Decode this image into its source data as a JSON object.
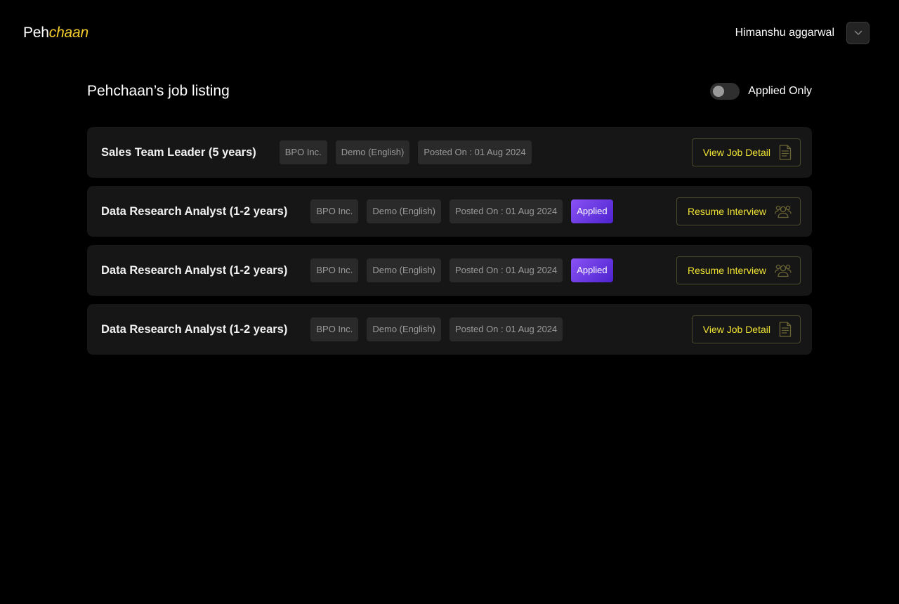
{
  "header": {
    "logo_plain": "Peh",
    "logo_accent": "chaan",
    "user_name": "Himanshu aggarwal",
    "menu_icon": "chevron-down-icon"
  },
  "page": {
    "title": "Pehchaan’s job listing",
    "toggle_label": "Applied Only",
    "toggle_on": false
  },
  "jobs": [
    {
      "title": "Sales Team Leader (5 years)",
      "company": "BPO Inc.",
      "language": "Demo (English)",
      "posted": "Posted On : 01 Aug 2024",
      "applied_label": "",
      "action_label": "View Job Detail",
      "action_icon": "document-icon"
    },
    {
      "title": "Data Research Analyst (1-2 years)",
      "company": "BPO Inc.",
      "language": "Demo (English)",
      "posted": "Posted On : 01 Aug 2024",
      "applied_label": "Applied",
      "action_label": "Resume Interview",
      "action_icon": "users-icon"
    },
    {
      "title": "Data Research Analyst (1-2 years)",
      "company": "BPO Inc.",
      "language": "Demo (English)",
      "posted": "Posted On : 01 Aug 2024",
      "applied_label": "Applied",
      "action_label": "Resume Interview",
      "action_icon": "users-icon"
    },
    {
      "title": "Data Research Analyst (1-2 years)",
      "company": "BPO Inc.",
      "language": "Demo (English)",
      "posted": "Posted On : 01 Aug 2024",
      "applied_label": "",
      "action_label": "View Job Detail",
      "action_icon": "document-icon"
    }
  ],
  "colors": {
    "background": "#000000",
    "card": "#161616",
    "tag_bg": "#2a2a2a",
    "accent_yellow": "#f0e334",
    "logo_yellow": "#f5cf2d",
    "applied_gradient_start": "#8a52f5",
    "applied_gradient_end": "#4d23cf"
  }
}
